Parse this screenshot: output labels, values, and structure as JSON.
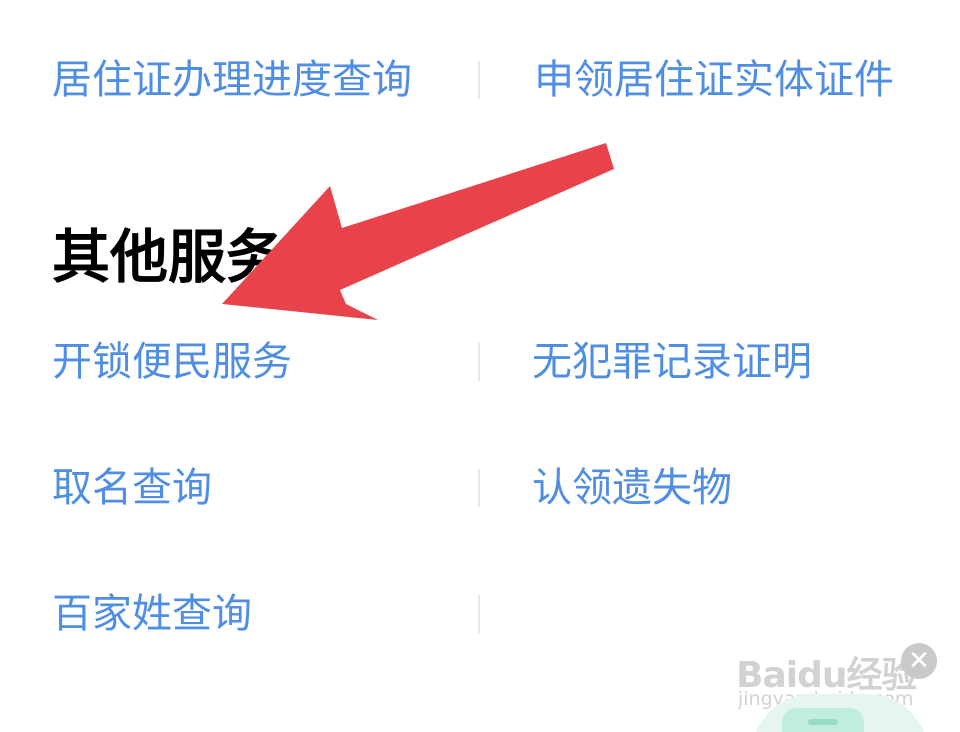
{
  "top_row": {
    "left_link": "居住证办理进度查询",
    "right_link": "申领居住证实体证件"
  },
  "section": {
    "title": "其他服务"
  },
  "services": [
    {
      "left": "开锁便民服务",
      "right": "无犯罪记录证明"
    },
    {
      "left": "取名查询",
      "right": "认领遗失物"
    },
    {
      "left": "百家姓查询",
      "right": ""
    }
  ],
  "watermark": {
    "logo_text": "Baidu经验",
    "url_text": "jingyan.baidu.com"
  },
  "overlay": {
    "arrow_color": "#e8434a",
    "close_symbol": "✕"
  },
  "colors": {
    "link": "#4f8ee3",
    "title": "#000000",
    "divider": "#e6e6e6"
  }
}
